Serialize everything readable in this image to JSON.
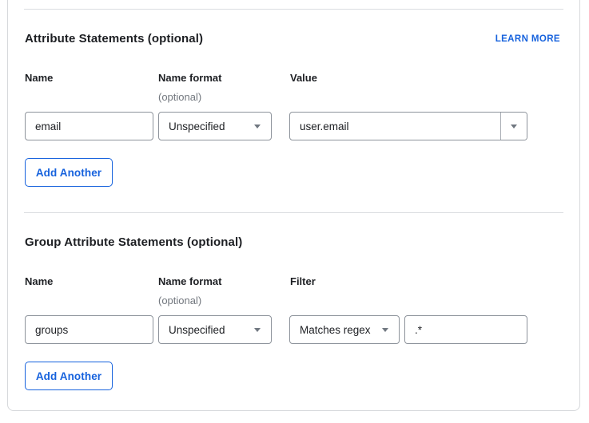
{
  "colors": {
    "accent_blue": "#1662dd",
    "text": "#1d1f23",
    "muted_text": "#72777e",
    "input_border": "#8d939b",
    "card_border": "#d7d9dc"
  },
  "icons": {
    "caret_down": "triangle-down-glyph"
  },
  "sections": [
    {
      "title": "Attribute Statements (optional)",
      "learn_more_label": "LEARN MORE",
      "columns": [
        {
          "label": "Name",
          "sub": ""
        },
        {
          "label": "Name format",
          "sub": "(optional)"
        },
        {
          "label": "Value",
          "sub": ""
        }
      ],
      "row": {
        "name": "email",
        "name_format": "Unspecified",
        "value": "user.email"
      },
      "add_button_label": "Add Another"
    },
    {
      "title": "Group Attribute Statements (optional)",
      "columns": [
        {
          "label": "Name",
          "sub": ""
        },
        {
          "label": "Name format",
          "sub": "(optional)"
        },
        {
          "label": "Filter",
          "sub": ""
        }
      ],
      "row": {
        "name": "groups",
        "name_format": "Unspecified",
        "filter_type": "Matches regex",
        "filter_value": ".*"
      },
      "add_button_label": "Add Another"
    }
  ]
}
